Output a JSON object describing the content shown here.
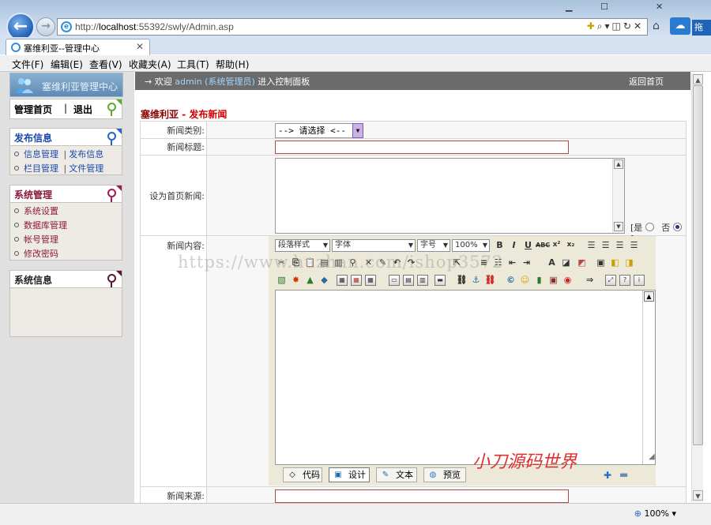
{
  "browser": {
    "url_prefix": "http://",
    "url_host": "localhost",
    "url_rest": ":55392/swly/Admin.asp",
    "tab_title": "塞维利亚--管理中心",
    "drag_label": "拖",
    "menu": [
      "文件(F)",
      "编辑(E)",
      "查看(V)",
      "收藏夹(A)",
      "工具(T)",
      "帮助(H)"
    ],
    "zoom": "100%"
  },
  "sidebar": {
    "logo_text": "塞维利亚管理中心",
    "box1": {
      "item_home": "管理首页",
      "sep": "|",
      "item_exit": "退出"
    },
    "box2": {
      "title": "发布信息",
      "rows": [
        {
          "a": "信息管理",
          "sep": "|",
          "b": "发布信息"
        },
        {
          "a": "栏目管理",
          "sep": "|",
          "b": "文件管理"
        }
      ]
    },
    "box3": {
      "title": "系统管理",
      "items": [
        "系统设置",
        "数据库管理",
        "帐号管理",
        "修改密码"
      ]
    },
    "box4": {
      "title": "系统信息"
    }
  },
  "topbar": {
    "arrow": "→",
    "welcome": "欢迎",
    "admin": "admin (系统管理员)",
    "tail": "进入控制面板",
    "back_home": "返回首页"
  },
  "form": {
    "title_site": "塞维利亚",
    "title_dash": " - ",
    "title_action": "发布新闻",
    "category_label": "新闻类别:",
    "category_value": "--> 请选择 <--",
    "title_label": "新闻标题:",
    "title_value": "",
    "home_label": "设为首页新闻:",
    "yes_label": "[是",
    "no_label": "否",
    "close_bracket": "]",
    "content_label": "新闻内容:",
    "source_label": "新闻来源:",
    "source_value": ""
  },
  "editor": {
    "paragraph_select": "段落样式",
    "font_select": "字体",
    "size_select": "字号",
    "zoom_select": "100%",
    "mode_tabs": [
      "代码",
      "设计",
      "文本",
      "预览"
    ],
    "active_mode": "设计"
  },
  "watermarks": {
    "url": "https://www.huzhan.com/ishop3572",
    "brand": "小刀源码世界"
  }
}
